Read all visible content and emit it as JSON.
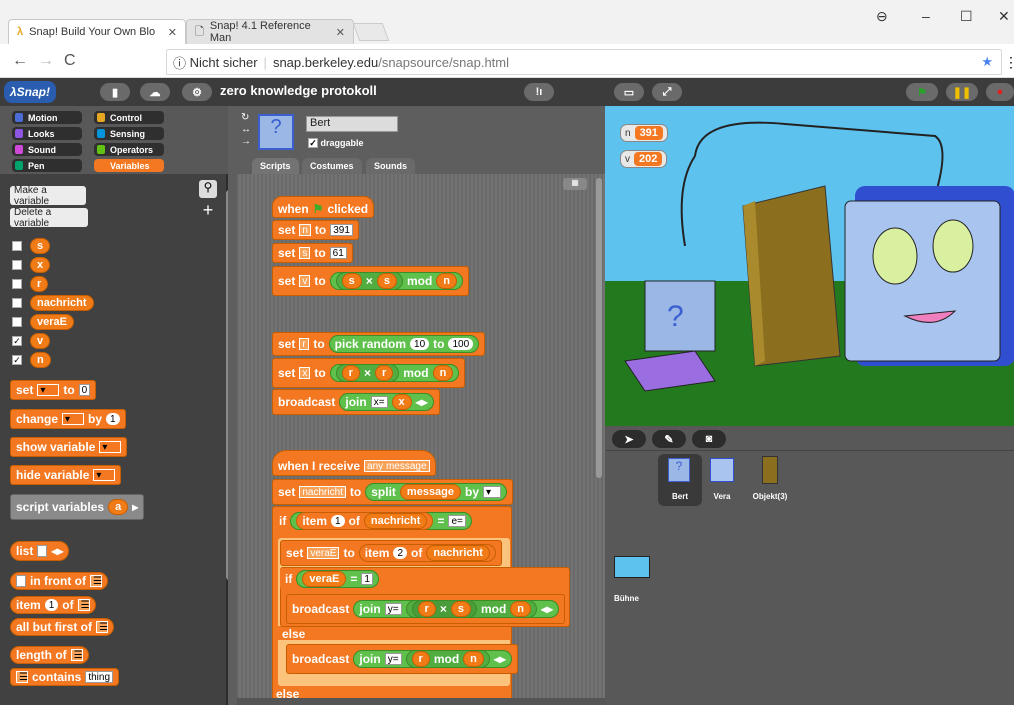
{
  "browser": {
    "tabs": [
      {
        "title": "Snap! Build Your Own Blo"
      },
      {
        "title": "Snap! 4.1 Reference Man"
      }
    ],
    "secure_label": "Nicht sicher",
    "url_host": "snap.berkeley.edu",
    "url_path": "/snapsource/snap.html"
  },
  "app": {
    "project_name": "zero knowledge protokoll"
  },
  "categories": [
    "Motion",
    "Control",
    "Looks",
    "Sensing",
    "Sound",
    "Operators",
    "Pen",
    "Variables"
  ],
  "category_colors": [
    "#4a6cd4",
    "#e6a822",
    "#8f56e3",
    "#0494dc",
    "#cf4ad9",
    "#62c213",
    "#00a36b",
    "#f37821"
  ],
  "palette": {
    "make_variable": "Make a variable",
    "delete_variable": "Delete a variable",
    "variables": [
      {
        "name": "s",
        "checked": false
      },
      {
        "name": "x",
        "checked": false
      },
      {
        "name": "r",
        "checked": false
      },
      {
        "name": "nachricht",
        "checked": false
      },
      {
        "name": "veraE",
        "checked": false
      },
      {
        "name": "v",
        "checked": true
      },
      {
        "name": "n",
        "checked": true
      }
    ],
    "blocks": {
      "set": "set",
      "to": "to",
      "set_val": "0",
      "change": "change",
      "by": "by",
      "change_val": "1",
      "show": "show variable",
      "hide": "hide variable",
      "script_vars": "script variables",
      "script_var": "a",
      "list": "list",
      "in_front_of": "in front of",
      "item": "item",
      "item_val": "1",
      "of": "of",
      "all_but_first": "all but first of",
      "length_of": "length of",
      "contains": "contains",
      "thing": "thing"
    }
  },
  "sprite": {
    "name": "Bert",
    "draggable": "draggable",
    "tabs": [
      "Scripts",
      "Costumes",
      "Sounds"
    ]
  },
  "script": {
    "when": "when",
    "clicked": "clicked",
    "set": "set",
    "to": "to",
    "n": "n",
    "s": "s",
    "v": "v",
    "r": "r",
    "x": "x",
    "nachricht": "nachricht",
    "veraE": "veraE",
    "n_val": "391",
    "s_val": "61",
    "times": "×",
    "mod": "mod",
    "pick_random": "pick random",
    "rand_lo": "10",
    "rand_hi": "100",
    "broadcast": "broadcast",
    "join": "join",
    "x_eq": "x=",
    "y_eq": "y=",
    "when_receive": "when I receive",
    "any_message": "any message",
    "split": "split",
    "message": "message",
    "by": "by",
    "if": "if",
    "item": "item",
    "item1": "1",
    "item2": "2",
    "of": "of",
    "e_eq": "e=",
    "eq": "=",
    "one": "1",
    "else": "else"
  },
  "watchers": [
    {
      "name": "n",
      "value": "391"
    },
    {
      "name": "v",
      "value": "202"
    }
  ],
  "corral": {
    "sprites": [
      "Bert",
      "Vera",
      "Objekt(3)"
    ],
    "stage": "Bühne"
  }
}
